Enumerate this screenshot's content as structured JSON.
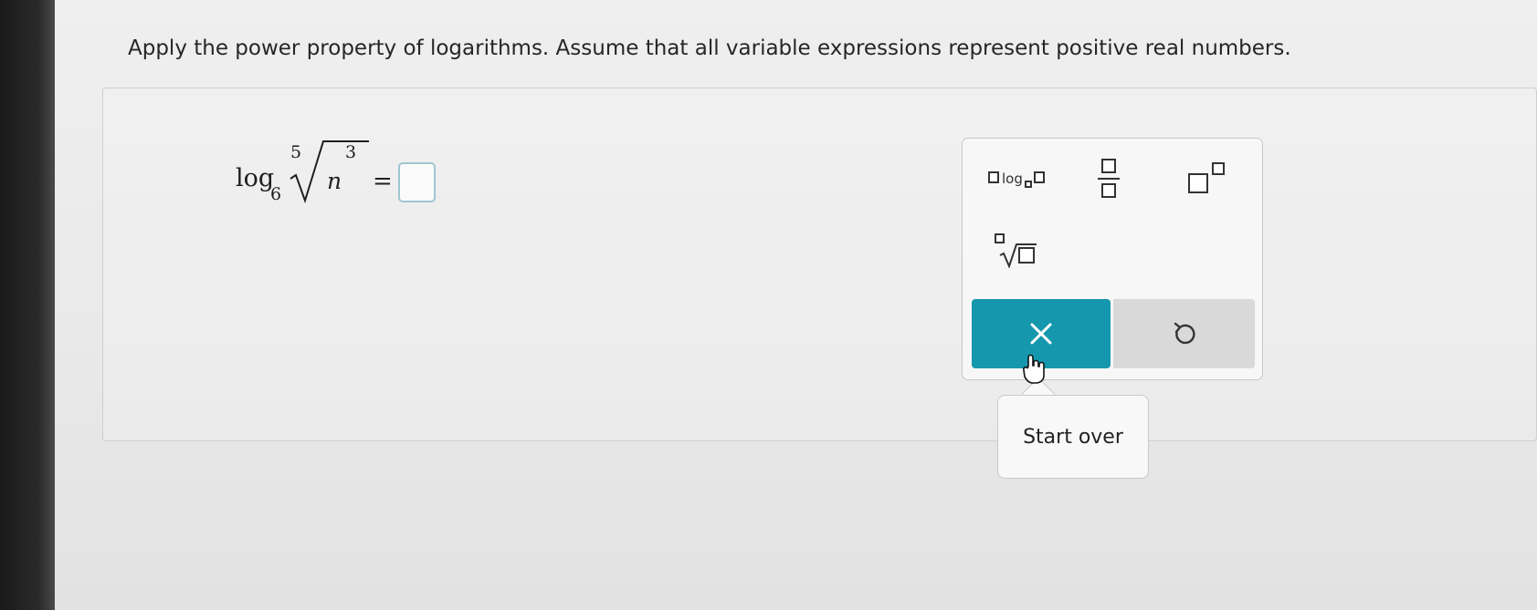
{
  "instruction": "Apply the power property of logarithms. Assume that all variable expressions represent positive real numbers.",
  "expression": {
    "log_word": "log",
    "log_base": "6",
    "root_index": "5",
    "radicand_var": "n",
    "radicand_exponent": "3",
    "equals": "="
  },
  "answer": {
    "value": ""
  },
  "palette": {
    "log_template_text": "log",
    "buttons": [
      "log-base-template",
      "fraction-template",
      "exponent-template",
      "nth-root-template"
    ],
    "clear_icon": "close-icon",
    "undo_icon": "undo-icon"
  },
  "tooltip": {
    "text": "Start over"
  },
  "colors": {
    "clear_button": "#1597ad",
    "undo_button": "#d9d9d9",
    "input_border": "#9ec6cf"
  }
}
